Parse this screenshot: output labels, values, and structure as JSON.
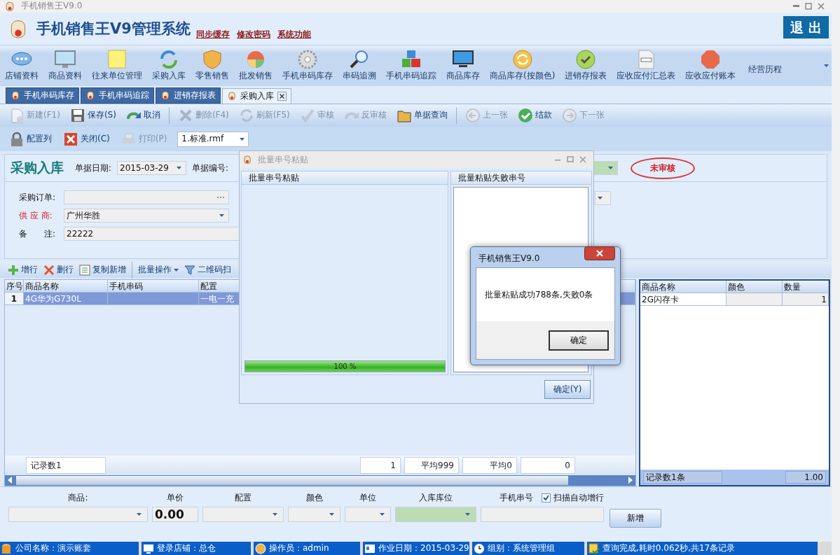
{
  "window": {
    "title": "手机销售王V9.0"
  },
  "header": {
    "title": "手机销售王V9管理系统",
    "links": [
      "同步缓存",
      "修改密码",
      "系统功能"
    ],
    "exit_button": "退 出"
  },
  "ribbon": [
    "店铺资料",
    "商品资料",
    "往来单位管理",
    "采购入库",
    "零售销售",
    "批发销售",
    "手机串码库存",
    "串码追溯",
    "手机串码追踪",
    "商品库存",
    "商品库存(按颜色)",
    "进销存报表",
    "应收应付汇总表",
    "应收应付账本",
    "经营历程"
  ],
  "tabs": [
    {
      "label": "手机串码库存",
      "selected": false
    },
    {
      "label": "手机串码追踪",
      "selected": false
    },
    {
      "label": "进销存报表",
      "selected": false
    },
    {
      "label": "采购入库",
      "selected": true
    }
  ],
  "toolbar": [
    {
      "label": "新建(F1)",
      "disabled": true
    },
    {
      "label": "保存(S)",
      "disabled": false
    },
    {
      "label": "取消",
      "disabled": false
    },
    {
      "label": "删除(F4)",
      "disabled": true
    },
    {
      "label": "刷新(F5)",
      "disabled": true
    },
    {
      "label": "审核",
      "disabled": true
    },
    {
      "label": "反审核",
      "disabled": true
    },
    {
      "label": "单据查询",
      "disabled": false
    },
    {
      "label": "上一张",
      "disabled": true
    },
    {
      "label": "结款",
      "disabled": false
    },
    {
      "label": "下一张",
      "disabled": true
    }
  ],
  "toolbar2": {
    "items": [
      {
        "label": "配置列",
        "disabled": false
      },
      {
        "label": "关闭(C)",
        "disabled": false
      },
      {
        "label": "打印(P)",
        "disabled": true
      }
    ],
    "template": "1.标准.rmf"
  },
  "form": {
    "title": "采购入库",
    "date_label": "单据日期:",
    "date": "2015-03-29",
    "number_label": "单据编号:",
    "status": "未审核",
    "fields": [
      {
        "label": "采购订单:",
        "kind": "lookup",
        "required": false
      },
      {
        "label": "供 应 商:",
        "kind": "dropdown",
        "value": "广州华胜",
        "required": true
      },
      {
        "label": "备　　注:",
        "kind": "text",
        "value": "22222",
        "required": false
      }
    ]
  },
  "grid_toolbar": [
    {
      "label": "增行",
      "kind": "button"
    },
    {
      "label": "删行",
      "kind": "button"
    },
    {
      "label": "复制新增",
      "kind": "button"
    },
    {
      "label": "批量操作",
      "kind": "menu"
    },
    {
      "label": "二维码扫",
      "kind": "button"
    }
  ],
  "grid": {
    "columns": [
      "序号",
      "商品名称",
      "手机串码",
      "配置"
    ],
    "rows": [
      {
        "index": "1",
        "name": "4G华为G730L",
        "config": "一电一充",
        "selected": true
      }
    ],
    "totals": [
      "记录数1",
      "1",
      "平均999",
      "平均0",
      "0"
    ]
  },
  "side_grid": {
    "columns": [
      "商品名称",
      "颜色",
      "数量"
    ],
    "rows": [
      {
        "name": "2G闪存卡",
        "quantity": "1"
      }
    ],
    "footer": [
      "记录数1条",
      "1.00"
    ]
  },
  "entry": {
    "fields": [
      {
        "label": "商品:",
        "kind": "dropdown"
      },
      {
        "label": "单价",
        "kind": "value",
        "value": "0.00"
      },
      {
        "label": "配置",
        "kind": "dropdown"
      },
      {
        "label": "颜色",
        "kind": "dropdown"
      },
      {
        "label": "单位",
        "kind": "dropdown"
      },
      {
        "label": "入库库位",
        "kind": "dropdown",
        "disabled": true
      },
      {
        "label": "手机串号",
        "kind": "text"
      }
    ],
    "auto_row": {
      "label": "扫描自动增行",
      "checked": true
    },
    "add_button": "新增"
  },
  "status_bar": [
    "公司名称：演示账套",
    "登录店铺：总仓",
    "操作员：admin",
    "作业日期：2015-03-29",
    "组别：系统管理组",
    "查询完成,耗时0.062秒,共17条记录"
  ],
  "paste_dialog": {
    "title": "批量串号粘贴",
    "active": false,
    "left_header": "批量串号粘贴",
    "right_header": "批量粘贴失败串号",
    "progress": {
      "level": 1,
      "label": "100 %"
    },
    "ok_button": "确定(Y)"
  },
  "message_box": {
    "title": "手机销售王V9.0",
    "message": "批量粘贴成功788条,失败0条",
    "ok_button": "确定"
  }
}
